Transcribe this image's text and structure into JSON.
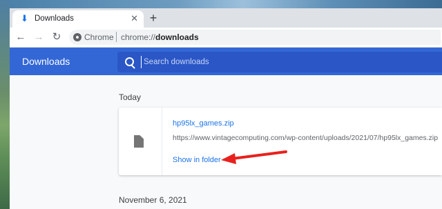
{
  "tab": {
    "title": "Downloads",
    "close": "✕",
    "new_tab": "+"
  },
  "toolbar": {
    "back": "←",
    "forward": "→",
    "reload": "↻",
    "site_label": "Chrome",
    "url_scheme": "chrome://",
    "url_path": "downloads"
  },
  "header": {
    "title": "Downloads",
    "search_placeholder": "Search downloads"
  },
  "sections": [
    {
      "label": "Today"
    },
    {
      "label": "November 6, 2021"
    }
  ],
  "download": {
    "file_name": "hp95lx_games.zip",
    "url": "https://www.vintagecomputing.com/wp-content/uploads/2021/07/hp95lx_games.zip",
    "action": "Show in folder"
  },
  "colors": {
    "header_blue": "#3367d6",
    "link_blue": "#1a73e8",
    "arrow_red": "#e8211d"
  },
  "icons": [
    "download-icon",
    "close-icon",
    "plus-icon",
    "back-icon",
    "forward-icon",
    "reload-icon",
    "chrome-site-icon",
    "search-icon",
    "file-icon",
    "annotation-arrow"
  ]
}
